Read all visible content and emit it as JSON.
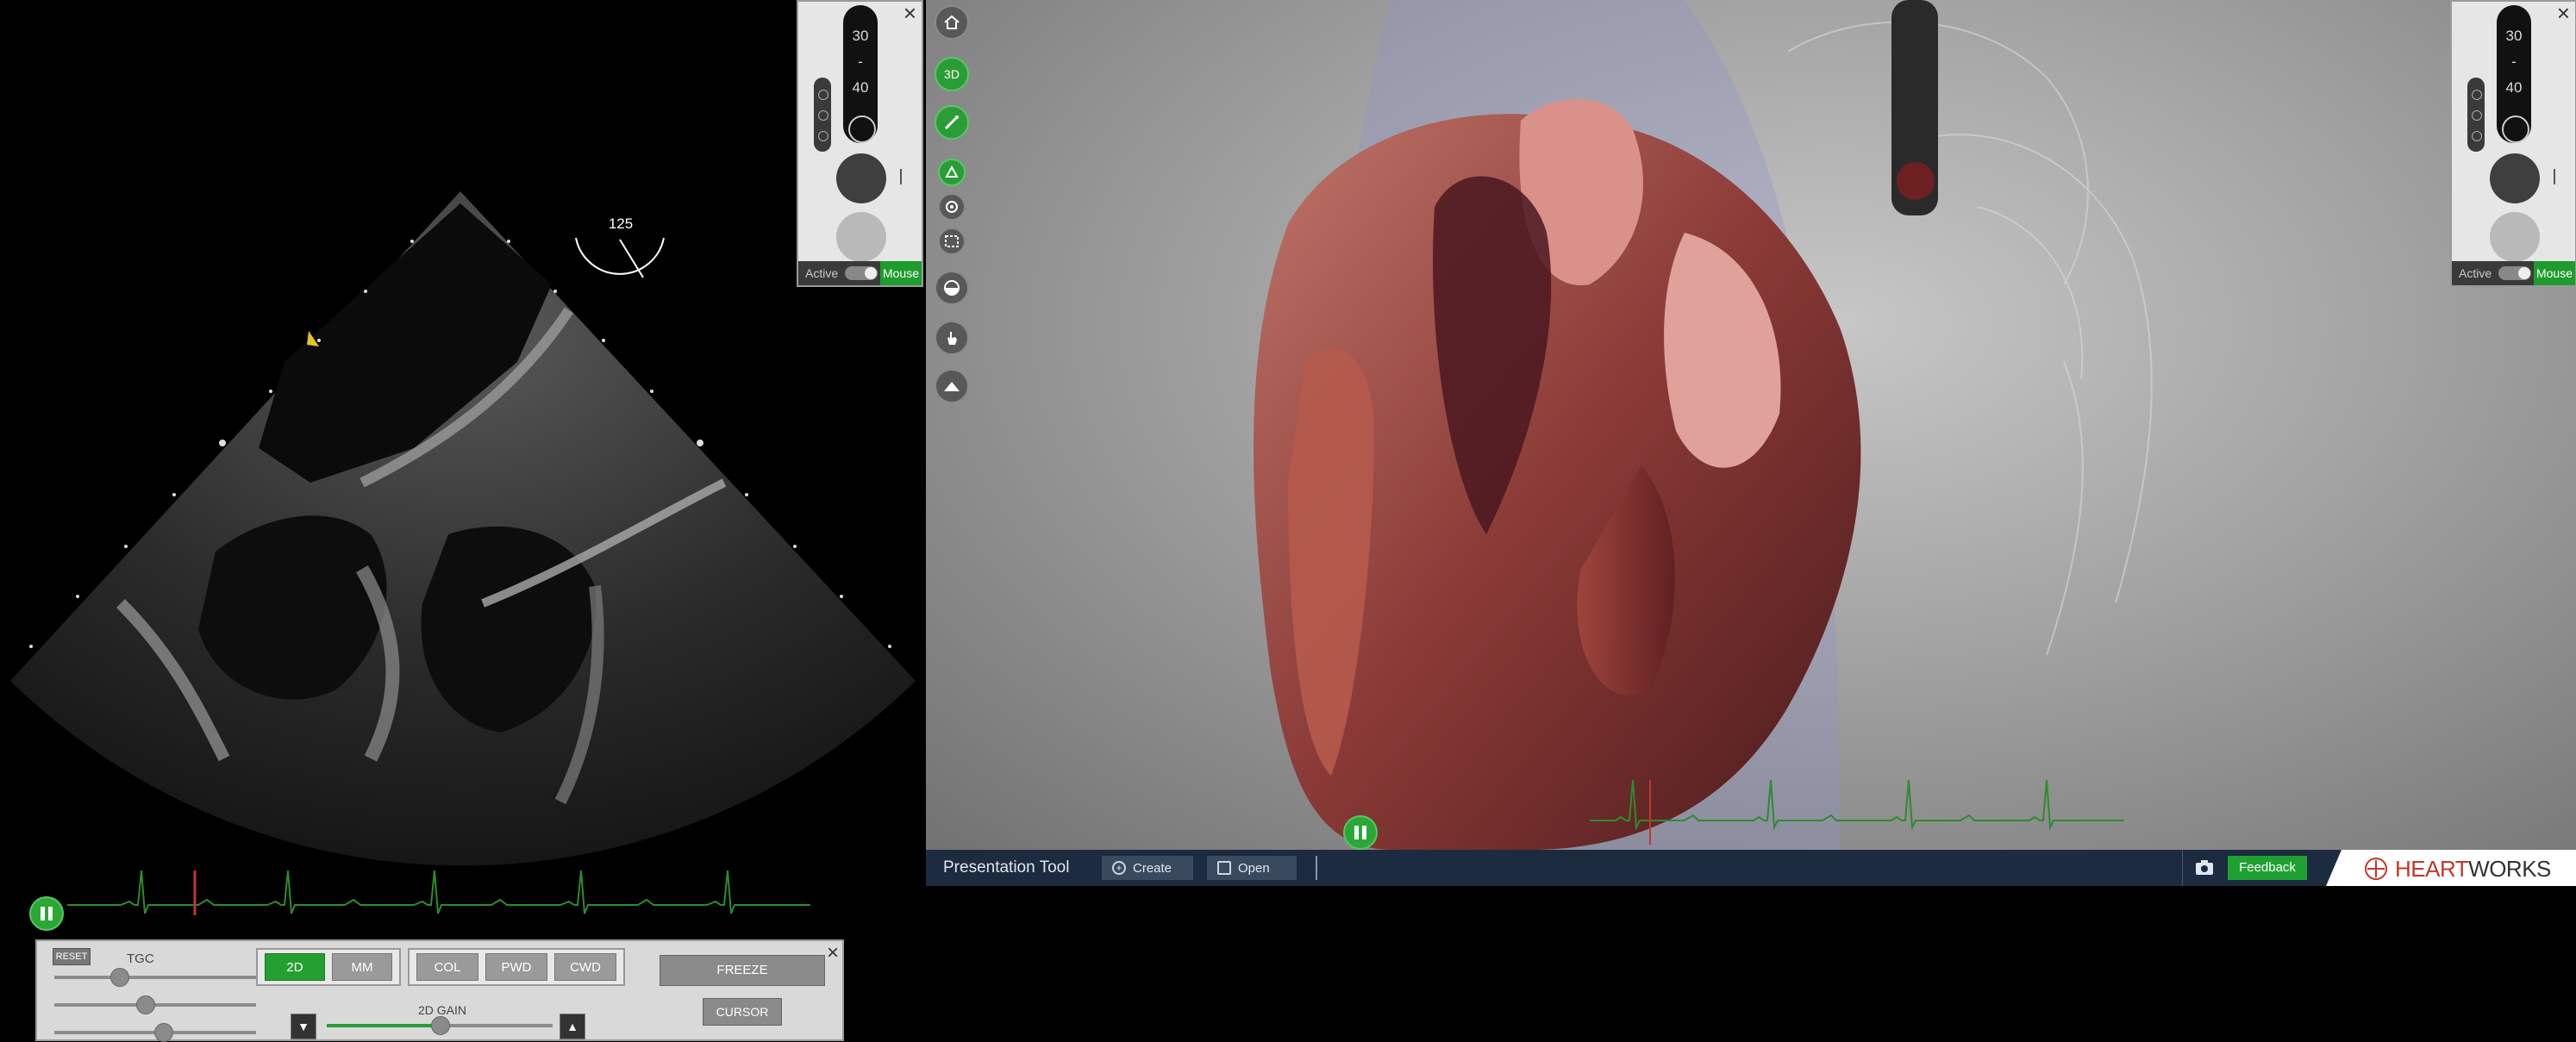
{
  "echo": {
    "angle_value": "125",
    "tgc_label": "TGC",
    "reset_label": "RESET",
    "gain_label": "2D GAIN",
    "mode_buttons": [
      {
        "label": "2D",
        "active": true
      },
      {
        "label": "MM",
        "active": false
      }
    ],
    "doppler_buttons": [
      {
        "label": "COL"
      },
      {
        "label": "PWD"
      },
      {
        "label": "CWD"
      }
    ],
    "freeze_label": "FREEZE",
    "cursor_label": "CURSOR",
    "tgc_levels": [
      0.32,
      0.45,
      0.54
    ],
    "gain_level": 0.5
  },
  "probe_panel": {
    "dial_values": [
      "30",
      "-",
      "40"
    ],
    "active_label": "Active",
    "mouse_label": "Mouse"
  },
  "presentation_bar": {
    "title": "Presentation Tool",
    "create_label": "Create",
    "open_label": "Open",
    "feedback_label": "Feedback",
    "brand_part1": "HEART",
    "brand_part2": "WORKS"
  },
  "toolbar": {
    "items": [
      "home-icon",
      "3d-view-icon",
      "probe-icon",
      "structures-icon",
      "target-icon",
      "crop-icon",
      "slice-icon",
      "hand-icon",
      "landscape-icon"
    ],
    "label_3d": "3D"
  },
  "colors": {
    "accent_green": "#2a9d36",
    "ecg_green": "#2e8b2e",
    "ecg_marker_red": "#c0392b",
    "pres_bar_bg": "#1c2b3f",
    "brand_red": "#c0392b"
  }
}
